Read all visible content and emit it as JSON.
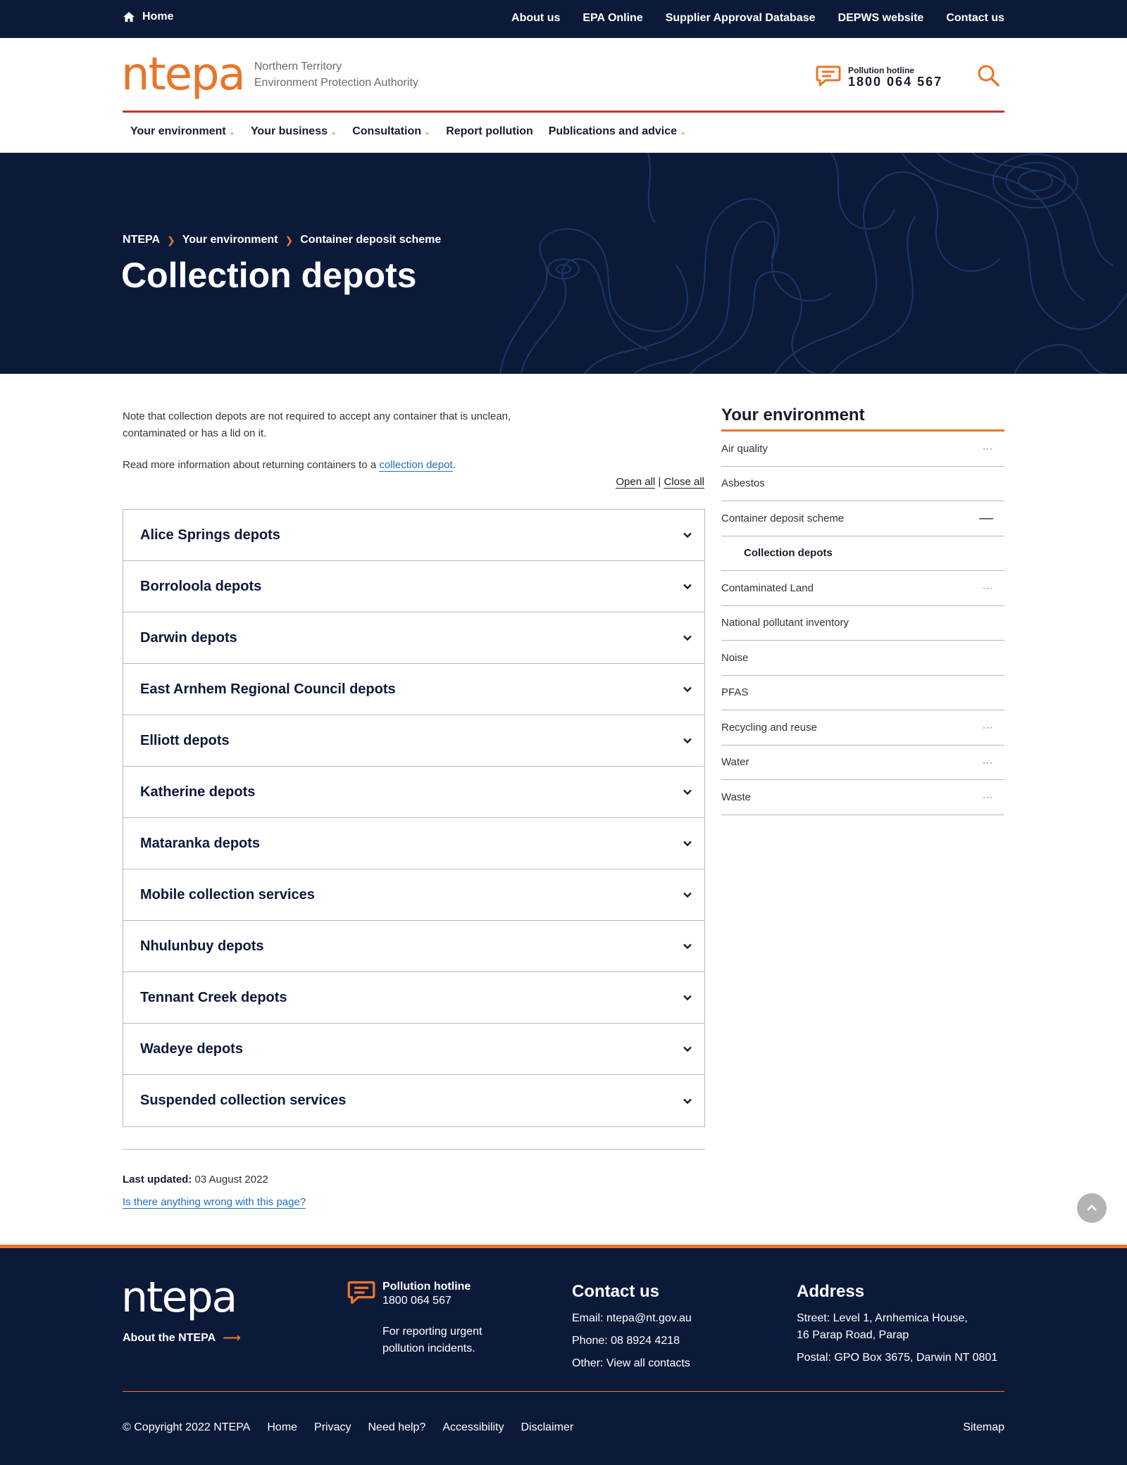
{
  "topbar": {
    "home_label": "Home",
    "links": [
      "About us",
      "EPA Online",
      "Supplier Approval Database",
      "DEPWS website",
      "Contact us"
    ]
  },
  "header": {
    "logo_mark": "ntepa",
    "logo_line1": "Northern Territory",
    "logo_line2": "Environment Protection Authority",
    "hotline_label": "Pollution hotline",
    "hotline_number": "1800 064 567",
    "search_icon": "search-icon"
  },
  "nav": {
    "items": [
      {
        "label": "Your environment",
        "has_menu": true
      },
      {
        "label": "Your business",
        "has_menu": true
      },
      {
        "label": "Consultation",
        "has_menu": true
      },
      {
        "label": "Report pollution",
        "has_menu": false
      },
      {
        "label": "Publications and advice",
        "has_menu": true
      }
    ]
  },
  "hero": {
    "breadcrumb": [
      "NTEPA",
      "Your environment",
      "Container deposit scheme"
    ],
    "title": "Collection depots"
  },
  "content": {
    "note": "Note that collection depots are not required to accept any container that is unclean, contaminated or has a lid on it.",
    "readmore_prefix": "Read more information about returning containers to a ",
    "readmore_link": "collection depot",
    "readmore_suffix": ".",
    "open_all": "Open all",
    "separator": "|",
    "close_all": "Close all",
    "accordion": [
      "Alice Springs depots",
      "Borroloola depots",
      "Darwin depots",
      "East Arnhem Regional Council depots",
      "Elliott depots",
      "Katherine depots",
      "Mataranka depots",
      "Mobile collection services",
      "Nhulunbuy depots",
      "Tennant Creek depots",
      "Wadeye depots",
      "Suspended collection services"
    ],
    "last_updated_label": "Last updated:",
    "last_updated_value": "03 August 2022",
    "wrong_link": "Is there anything wrong with this page?"
  },
  "sidebar": {
    "heading": "Your environment",
    "items": [
      {
        "label": "Air quality",
        "marker": "···"
      },
      {
        "label": "Asbestos",
        "marker": ""
      },
      {
        "label": "Container deposit scheme",
        "marker": "—"
      },
      {
        "label": "Collection depots",
        "sub": true
      },
      {
        "label": "Contaminated Land",
        "marker": "···"
      },
      {
        "label": "National pollutant inventory",
        "marker": ""
      },
      {
        "label": "Noise",
        "marker": ""
      },
      {
        "label": "PFAS",
        "marker": ""
      },
      {
        "label": "Recycling and reuse",
        "marker": "···"
      },
      {
        "label": "Water",
        "marker": "···"
      },
      {
        "label": "Waste",
        "marker": "···"
      }
    ]
  },
  "footer": {
    "logo_mark": "ntepa",
    "about_label": "About the NTEPA",
    "hotline_label": "Pollution hotline",
    "hotline_number": "1800 064 567",
    "hotline_desc": "For reporting urgent pollution incidents.",
    "contact_heading": "Contact us",
    "contact_email": "Email: ntepa@nt.gov.au",
    "contact_phone": "Phone: 08 8924 4218",
    "contact_other": "Other: View all contacts",
    "address_heading": "Address",
    "address_street_1": "Street: Level 1, Arnhemica House,",
    "address_street_2": "16 Parap Road, Parap",
    "address_postal": "Postal: GPO Box 3675, Darwin NT 0801",
    "bottom_links": [
      "© Copyright 2022 NTEPA",
      "Home",
      "Privacy",
      "Need help?",
      "Accessibility",
      "Disclaimer"
    ],
    "sitemap": "Sitemap"
  },
  "colors": {
    "navy": "#0c1a3a",
    "orange": "#e8752a",
    "red_rule": "#c0392b",
    "link_blue": "#1e6fc2"
  }
}
